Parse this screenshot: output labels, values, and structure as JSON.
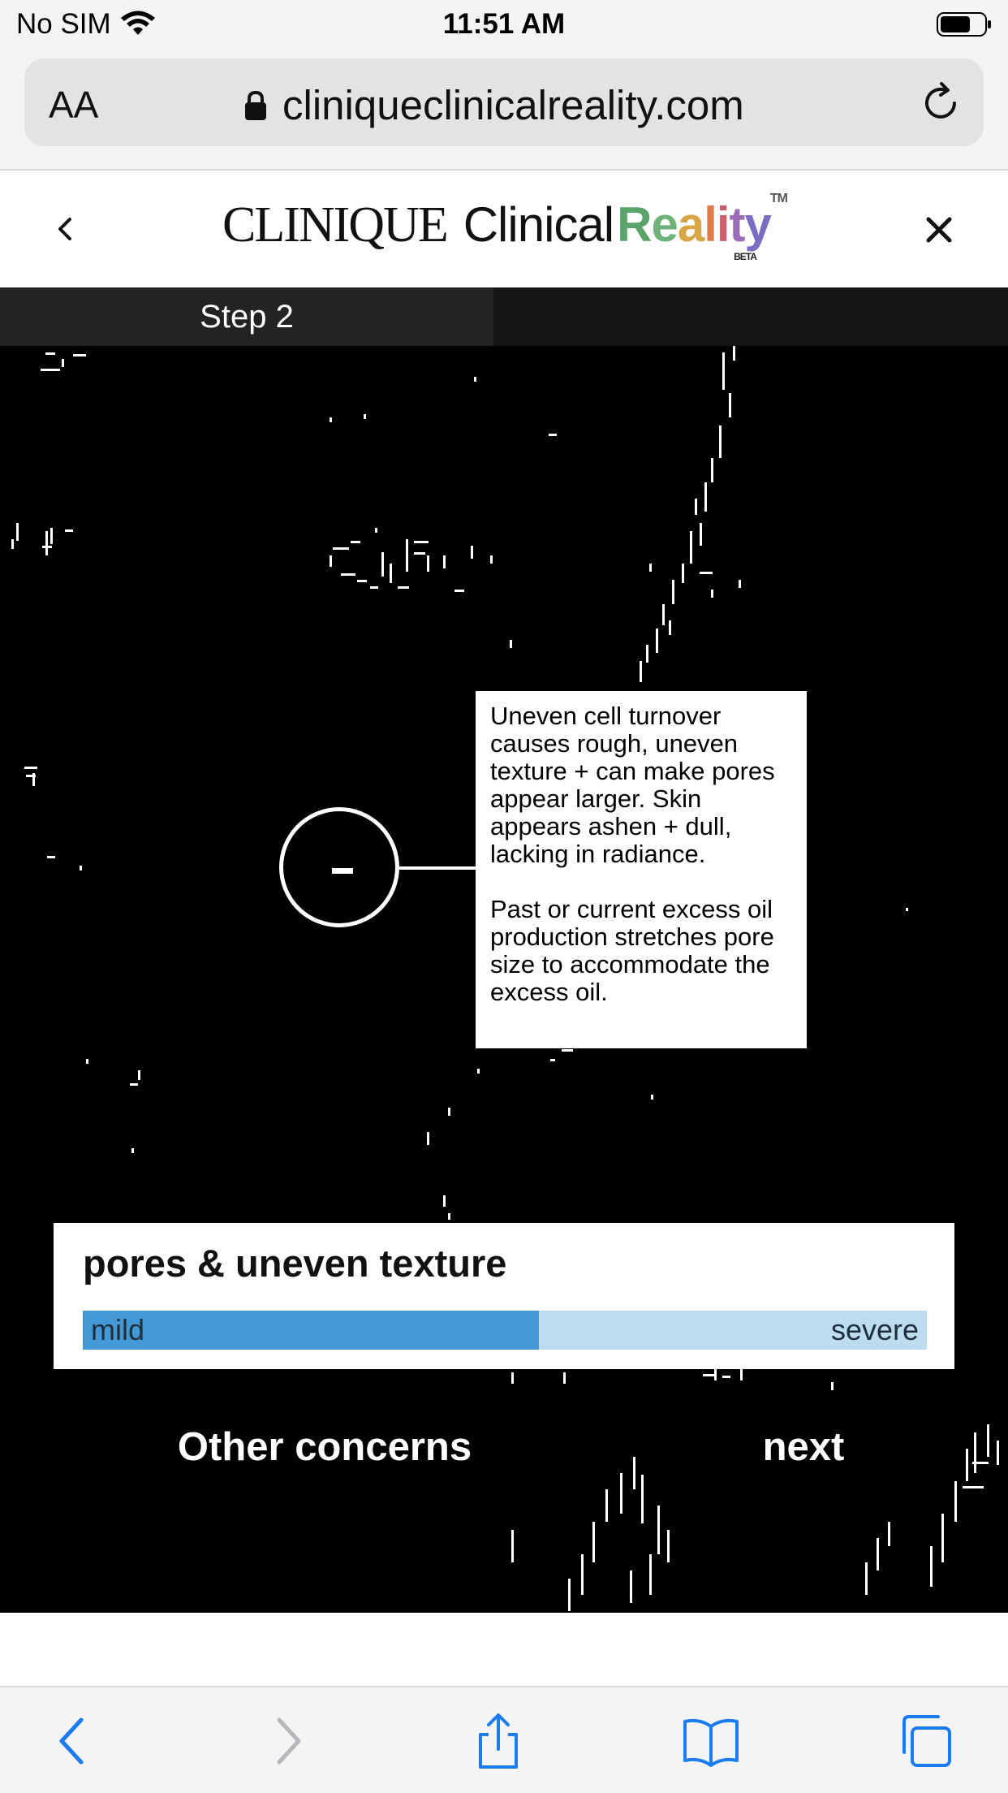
{
  "status_bar": {
    "carrier": "No SIM",
    "time": "11:51 AM"
  },
  "browser": {
    "aa_label": "AA",
    "url": "cliniqueclinicalreality.com"
  },
  "header": {
    "logo_brand": "CLINIQUE",
    "logo_clinical": "Clinical",
    "logo_reality": "Reality",
    "logo_tm": "TM",
    "logo_beta": "BETA"
  },
  "viewer": {
    "step_label": "Step 2",
    "marker_symbol": "-",
    "info_paragraphs": [
      "Uneven cell turnover causes rough, uneven texture + can make pores appear larger. Skin appears ashen + dull, lacking in radiance.",
      "Past or current excess oil production stretches pore size to accommodate the excess oil."
    ],
    "concern": {
      "title": "pores & uneven texture",
      "scale_min": "mild",
      "scale_max": "severe",
      "severity_fraction": 0.54
    },
    "buttons": {
      "other_concerns": "Other concerns",
      "next": "next"
    }
  },
  "colors": {
    "scale_fill": "#4399d6",
    "scale_track": "#bcdcf0",
    "ios_blue": "#1a7cf0"
  },
  "icons": {
    "wifi": "wifi-icon",
    "battery": "battery-icon",
    "lock": "lock-icon",
    "reload": "reload-icon",
    "back": "chevron-left-icon",
    "close": "close-icon",
    "share": "share-icon",
    "bookmarks": "book-icon",
    "tabs": "tabs-icon"
  }
}
